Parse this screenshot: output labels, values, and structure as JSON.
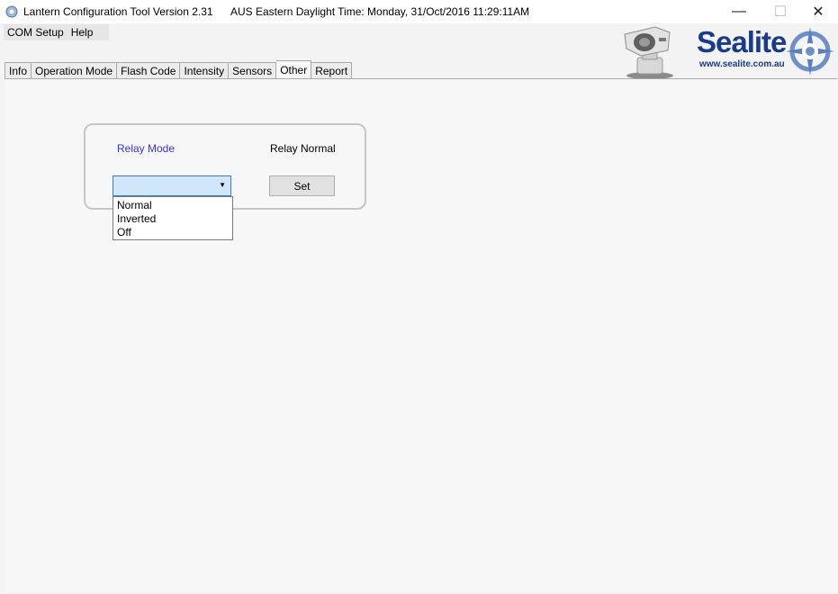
{
  "window": {
    "title": "Lantern Configuration Tool Version 2.31",
    "time_display": "AUS Eastern Daylight Time: Monday, 31/Oct/2016 11:29:11AM",
    "controls": {
      "minimize": "—",
      "maximize": "☐",
      "close": "✕"
    }
  },
  "menu": {
    "items": [
      "COM Setup",
      "Help"
    ]
  },
  "tabs": {
    "items": [
      "Info",
      "Operation Mode",
      "Flash Code",
      "Intensity",
      "Sensors",
      "Other",
      "Report"
    ],
    "active": "Other"
  },
  "relay": {
    "mode_label": "Relay Mode",
    "status": "Relay Normal",
    "combo_value": "",
    "options": [
      "Normal",
      "Inverted",
      "Off"
    ],
    "set_label": "Set"
  },
  "logo": {
    "brand": "Sealite",
    "url": "www.sealite.com.au",
    "color": "#1a3b8a"
  }
}
